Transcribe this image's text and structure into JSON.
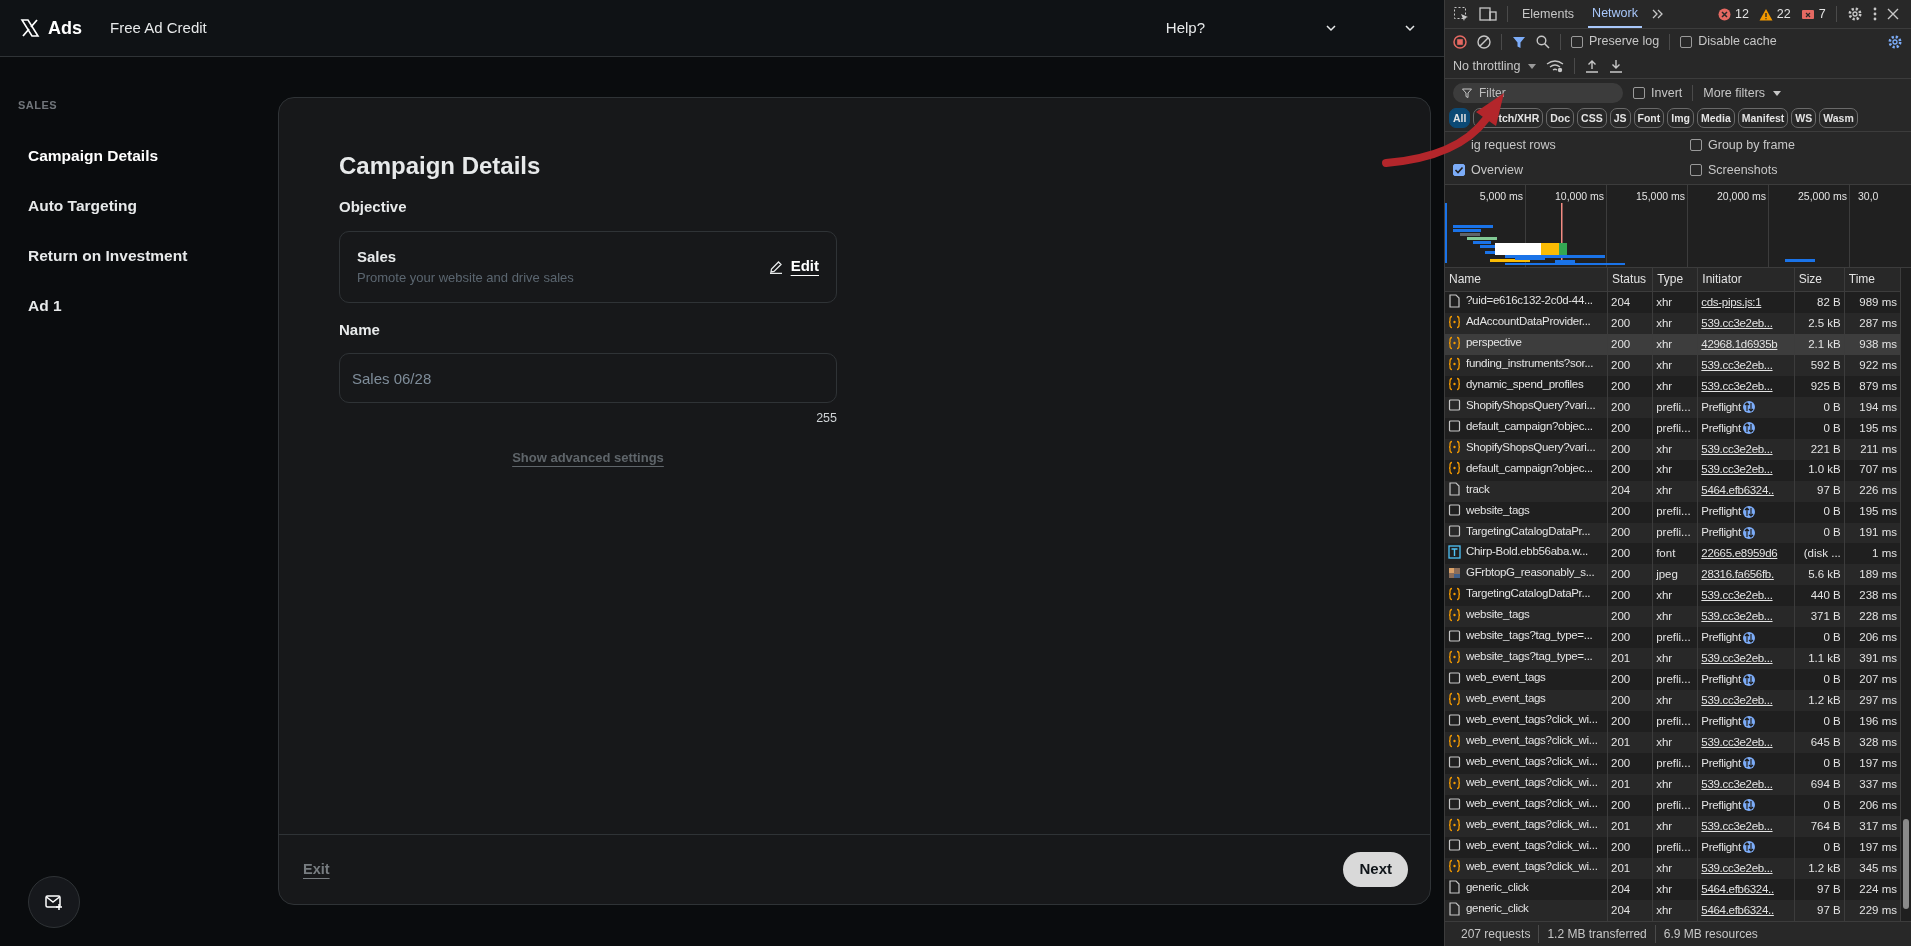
{
  "app": {
    "logo": "Ads",
    "nav_link": "Free Ad Credit",
    "help": "Help?"
  },
  "sidebar": {
    "section": "SALES",
    "items": [
      {
        "label": "Campaign Details",
        "selected": true
      },
      {
        "label": "Auto Targeting",
        "selected": false
      },
      {
        "label": "Return on Investment",
        "selected": false
      },
      {
        "label": "Ad 1",
        "selected": false
      }
    ]
  },
  "form": {
    "title": "Campaign Details",
    "objective_label": "Objective",
    "objective": {
      "name": "Sales",
      "description": "Promote your website and drive sales",
      "edit": "Edit"
    },
    "name_label": "Name",
    "name_value": "Sales 06/28",
    "char_count": "255",
    "advanced_link": "Show advanced settings",
    "exit": "Exit",
    "next": "Next"
  },
  "devtools": {
    "tabs": [
      {
        "label": "Elements",
        "selected": false
      },
      {
        "label": "Network",
        "selected": true
      }
    ],
    "errors": "12",
    "warnings": "22",
    "issues": "7",
    "toggles": [
      {
        "label": "Preserve log",
        "checked": false
      },
      {
        "label": "Disable cache",
        "checked": false
      }
    ],
    "throttling": "No throttling",
    "filter": {
      "placeholder": "Filter"
    },
    "invert": {
      "label": "Invert",
      "checked": false
    },
    "more_filters": "More filters",
    "type_chips": [
      {
        "label": "All",
        "selected": true
      },
      {
        "label": "tch/XHR",
        "selected": false
      },
      {
        "label": "Doc",
        "selected": false
      },
      {
        "label": "CSS",
        "selected": false
      },
      {
        "label": "JS",
        "selected": false
      },
      {
        "label": "Font",
        "selected": false
      },
      {
        "label": "Img",
        "selected": false
      },
      {
        "label": "Media",
        "selected": false
      },
      {
        "label": "Manifest",
        "selected": false
      },
      {
        "label": "WS",
        "selected": false
      },
      {
        "label": "Wasm",
        "selected": false
      }
    ],
    "options": [
      {
        "label": "ig request rows"
      },
      {
        "label": "Group by frame",
        "checked": false
      },
      {
        "label": "Overview",
        "checked": true
      },
      {
        "label": "Screenshots",
        "checked": false
      }
    ],
    "overview_ticks": [
      "5,000 ms",
      "10,000 ms",
      "15,000 ms",
      "20,000 ms",
      "25,000 ms",
      "30,0"
    ],
    "table": {
      "columns": [
        "Name",
        "Status",
        "Type",
        "Initiator",
        "Size",
        "Time"
      ],
      "rows": [
        {
          "kind": "doc",
          "name": "?uid=e616c132-2c0d-44...",
          "status": "204",
          "type": "xhr",
          "initiator": "cds-pips.js:1",
          "size": "82 B",
          "time": "989 ms",
          "selected": false
        },
        {
          "kind": "fetch",
          "name": "AdAccountDataProvider...",
          "status": "200",
          "type": "xhr",
          "initiator": "539.cc3e2eb...",
          "size": "2.5 kB",
          "time": "287 ms",
          "selected": false
        },
        {
          "kind": "fetch",
          "name": "perspective",
          "status": "200",
          "type": "xhr",
          "initiator": "42968.1d6935b",
          "size": "2.1 kB",
          "time": "938 ms",
          "selected": true
        },
        {
          "kind": "fetch",
          "name": "funding_instruments?sor...",
          "status": "200",
          "type": "xhr",
          "initiator": "539.cc3e2eb...",
          "size": "592 B",
          "time": "922 ms",
          "selected": false
        },
        {
          "kind": "fetch",
          "name": "dynamic_spend_profiles",
          "status": "200",
          "type": "xhr",
          "initiator": "539.cc3e2eb...",
          "size": "925 B",
          "time": "879 ms",
          "selected": false
        },
        {
          "kind": "preflight",
          "name": "ShopifyShopsQuery?vari...",
          "status": "200",
          "type": "prefli...",
          "initiator": "Preflight",
          "size": "0 B",
          "time": "194 ms",
          "selected": false
        },
        {
          "kind": "preflight",
          "name": "default_campaign?objec...",
          "status": "200",
          "type": "prefli...",
          "initiator": "Preflight",
          "size": "0 B",
          "time": "195 ms",
          "selected": false
        },
        {
          "kind": "fetch",
          "name": "ShopifyShopsQuery?vari...",
          "status": "200",
          "type": "xhr",
          "initiator": "539.cc3e2eb...",
          "size": "221 B",
          "time": "211 ms",
          "selected": false
        },
        {
          "kind": "fetch",
          "name": "default_campaign?objec...",
          "status": "200",
          "type": "xhr",
          "initiator": "539.cc3e2eb...",
          "size": "1.0 kB",
          "time": "707 ms",
          "selected": false
        },
        {
          "kind": "doc",
          "name": "track",
          "status": "204",
          "type": "xhr",
          "initiator": "5464.efb6324..",
          "size": "97 B",
          "time": "226 ms",
          "selected": false
        },
        {
          "kind": "preflight",
          "name": "website_tags",
          "status": "200",
          "type": "prefli...",
          "initiator": "Preflight",
          "size": "0 B",
          "time": "195 ms",
          "selected": false
        },
        {
          "kind": "preflight",
          "name": "TargetingCatalogDataPr...",
          "status": "200",
          "type": "prefli...",
          "initiator": "Preflight",
          "size": "0 B",
          "time": "191 ms",
          "selected": false
        },
        {
          "kind": "font",
          "name": "Chirp-Bold.ebb56aba.w...",
          "status": "200",
          "type": "font",
          "initiator": "22665.e8959d6",
          "size": "(disk ...",
          "time": "1 ms",
          "selected": false
        },
        {
          "kind": "image",
          "name": "GFrbtopG_reasonably_s...",
          "status": "200",
          "type": "jpeg",
          "initiator": "28316.fa656fb.",
          "size": "5.6 kB",
          "time": "189 ms",
          "selected": false
        },
        {
          "kind": "fetch",
          "name": "TargetingCatalogDataPr...",
          "status": "200",
          "type": "xhr",
          "initiator": "539.cc3e2eb...",
          "size": "440 B",
          "time": "238 ms",
          "selected": false
        },
        {
          "kind": "fetch",
          "name": "website_tags",
          "status": "200",
          "type": "xhr",
          "initiator": "539.cc3e2eb...",
          "size": "371 B",
          "time": "228 ms",
          "selected": false
        },
        {
          "kind": "preflight",
          "name": "website_tags?tag_type=...",
          "status": "200",
          "type": "prefli...",
          "initiator": "Preflight",
          "size": "0 B",
          "time": "206 ms",
          "selected": false
        },
        {
          "kind": "fetch",
          "name": "website_tags?tag_type=...",
          "status": "201",
          "type": "xhr",
          "initiator": "539.cc3e2eb...",
          "size": "1.1 kB",
          "time": "391 ms",
          "selected": false
        },
        {
          "kind": "preflight",
          "name": "web_event_tags",
          "status": "200",
          "type": "prefli...",
          "initiator": "Preflight",
          "size": "0 B",
          "time": "207 ms",
          "selected": false
        },
        {
          "kind": "fetch",
          "name": "web_event_tags",
          "status": "200",
          "type": "xhr",
          "initiator": "539.cc3e2eb...",
          "size": "1.2 kB",
          "time": "297 ms",
          "selected": false
        },
        {
          "kind": "preflight",
          "name": "web_event_tags?click_wi...",
          "status": "200",
          "type": "prefli...",
          "initiator": "Preflight",
          "size": "0 B",
          "time": "196 ms",
          "selected": false
        },
        {
          "kind": "fetch",
          "name": "web_event_tags?click_wi...",
          "status": "201",
          "type": "xhr",
          "initiator": "539.cc3e2eb...",
          "size": "645 B",
          "time": "328 ms",
          "selected": false
        },
        {
          "kind": "preflight",
          "name": "web_event_tags?click_wi...",
          "status": "200",
          "type": "prefli...",
          "initiator": "Preflight",
          "size": "0 B",
          "time": "197 ms",
          "selected": false
        },
        {
          "kind": "fetch",
          "name": "web_event_tags?click_wi...",
          "status": "201",
          "type": "xhr",
          "initiator": "539.cc3e2eb...",
          "size": "694 B",
          "time": "337 ms",
          "selected": false
        },
        {
          "kind": "preflight",
          "name": "web_event_tags?click_wi...",
          "status": "200",
          "type": "prefli...",
          "initiator": "Preflight",
          "size": "0 B",
          "time": "206 ms",
          "selected": false
        },
        {
          "kind": "fetch",
          "name": "web_event_tags?click_wi...",
          "status": "201",
          "type": "xhr",
          "initiator": "539.cc3e2eb...",
          "size": "764 B",
          "time": "317 ms",
          "selected": false
        },
        {
          "kind": "preflight",
          "name": "web_event_tags?click_wi...",
          "status": "200",
          "type": "prefli...",
          "initiator": "Preflight",
          "size": "0 B",
          "time": "197 ms",
          "selected": false
        },
        {
          "kind": "fetch",
          "name": "web_event_tags?click_wi...",
          "status": "201",
          "type": "xhr",
          "initiator": "539.cc3e2eb...",
          "size": "1.2 kB",
          "time": "345 ms",
          "selected": false
        },
        {
          "kind": "doc",
          "name": "generic_click",
          "status": "204",
          "type": "xhr",
          "initiator": "5464.efb6324..",
          "size": "97 B",
          "time": "224 ms",
          "selected": false
        },
        {
          "kind": "doc",
          "name": "generic_click",
          "status": "204",
          "type": "xhr",
          "initiator": "5464.efb6324..",
          "size": "97 B",
          "time": "229 ms",
          "selected": false
        }
      ]
    },
    "status_bar": [
      "207 requests",
      "1.2 MB transferred",
      "6.9 MB resources"
    ]
  }
}
